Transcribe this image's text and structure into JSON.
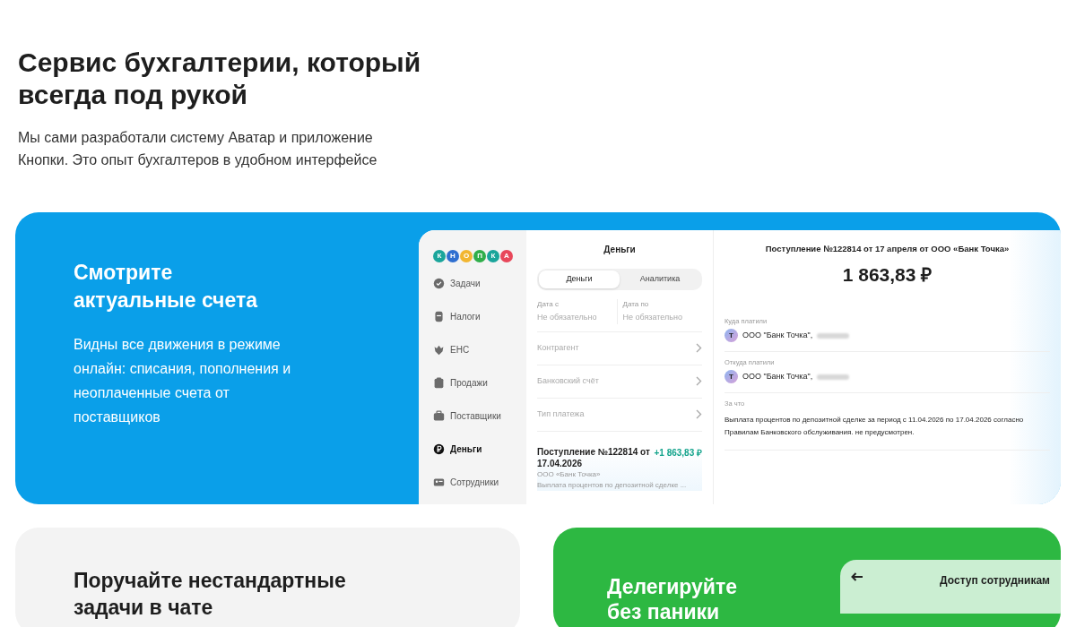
{
  "hero": {
    "title": "Сервис бухгалтерии, который всегда под рукой",
    "subtitle": "Мы сами разработали систему Аватар и приложение Кнопки. Это опыт бухгалтеров в удобном интерфейсе"
  },
  "accounts_card": {
    "title": "Смотрите актуальные счета",
    "text": "Видны все движения в режиме онлайн: списания, пополнения и неоплаченные счета от поставщиков"
  },
  "app": {
    "logo": [
      {
        "letter": "К",
        "color": "#1aa59b"
      },
      {
        "letter": "Н",
        "color": "#2f6fd0"
      },
      {
        "letter": "О",
        "color": "#f2b631"
      },
      {
        "letter": "П",
        "color": "#2fae4a"
      },
      {
        "letter": "К",
        "color": "#1aa59b"
      },
      {
        "letter": "А",
        "color": "#e8475a"
      }
    ],
    "nav": [
      {
        "kind": "tasks",
        "label": "Задачи",
        "selected": false
      },
      {
        "kind": "taxes",
        "label": "Налоги",
        "selected": false
      },
      {
        "kind": "ens",
        "label": "ЕНС",
        "selected": false
      },
      {
        "kind": "sales",
        "label": "Продажи",
        "selected": false
      },
      {
        "kind": "suppliers",
        "label": "Поставщики",
        "selected": false
      },
      {
        "kind": "money",
        "label": "Деньги",
        "selected": true
      },
      {
        "kind": "staff",
        "label": "Сотрудники",
        "selected": false
      }
    ],
    "list_title": "Деньги",
    "tabs": [
      {
        "label": "Деньги",
        "selected": true
      },
      {
        "label": "Аналитика",
        "selected": false
      }
    ],
    "date_fields": [
      {
        "label": "Дата с",
        "placeholder": "Не обязательно"
      },
      {
        "label": "Дата по",
        "placeholder": "Не обязательно"
      }
    ],
    "filters": [
      "Контрагент",
      "Банковский счёт",
      "Тип платежа"
    ],
    "transaction": {
      "title": "Поступление №122814 от 17.04.2026",
      "amount": "+1 863,83 ₽",
      "counterparty": "ООО «Банк Точка»",
      "description": "Выплата процентов по депозитной сделке ..."
    },
    "detail": {
      "title": "Поступление №122814 от 17 апреля от ООО «Банк Точка»",
      "amount": "1 863,83 ₽",
      "parties": [
        {
          "label": "Куда платили",
          "avatar": "Т",
          "name": "ООО \"Банк Точка\","
        },
        {
          "label": "Откуда платили",
          "avatar": "Т",
          "name": "ООО \"Банк Точка\","
        }
      ],
      "purpose_label": "За что",
      "purpose": "Выплата процентов по депозитной сделке за период с 11.04.2026 по 17.04.2026 согласно Правилам Банковского обслуживания. не предусмотрен."
    }
  },
  "chat_card": {
    "title": "Поручайте нестандартные задачи в чате"
  },
  "delegate_card": {
    "title": "Делегируйте без паники",
    "panel_title": "Доступ сотрудникам"
  }
}
